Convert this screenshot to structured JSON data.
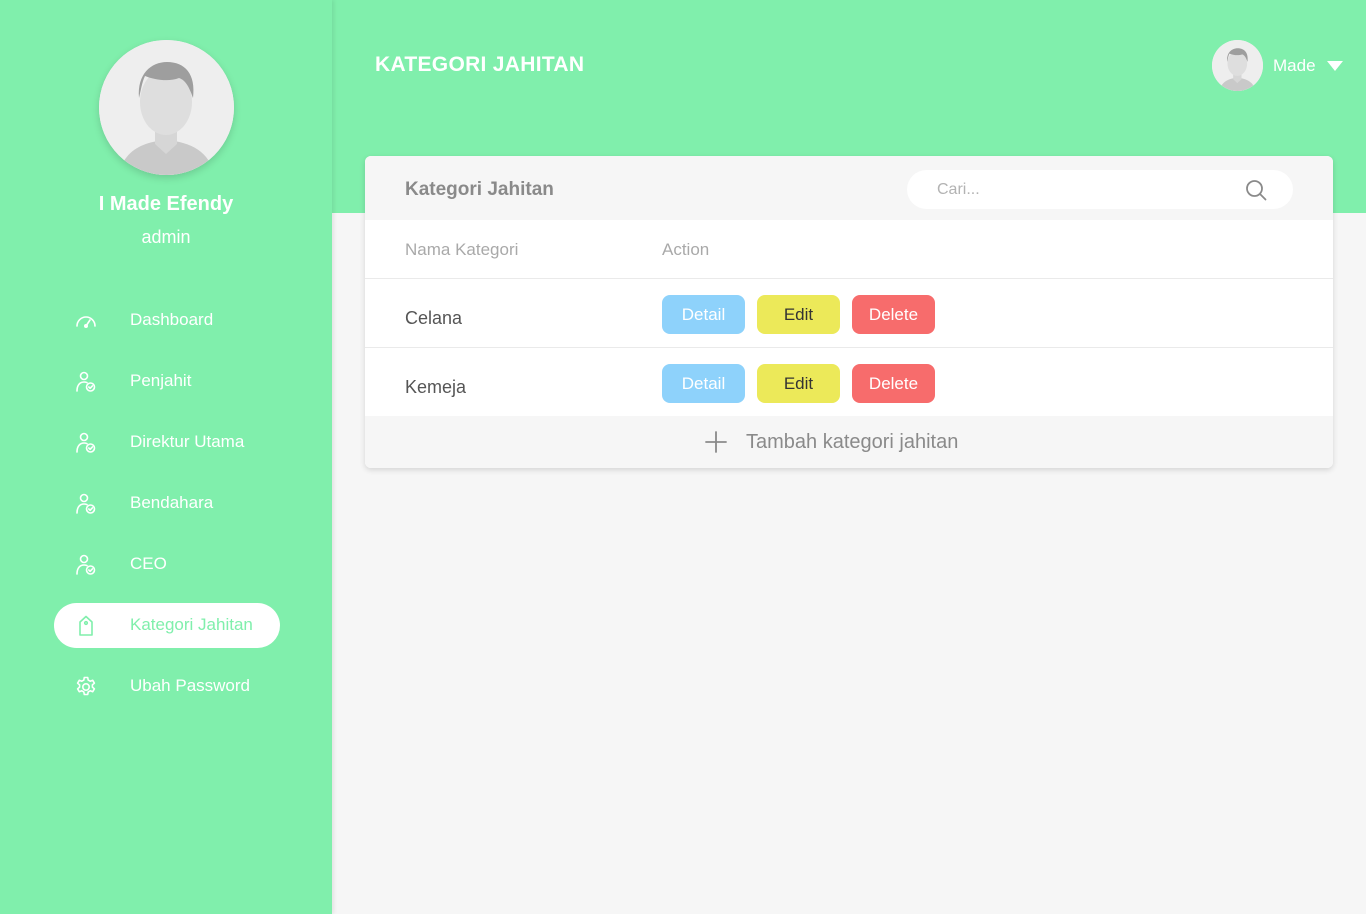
{
  "colors": {
    "accent": "#80efac",
    "detail": "#8ed2fb",
    "edit": "#ece959",
    "delete": "#f76c6c"
  },
  "sidebar": {
    "profile": {
      "name": "I Made Efendy",
      "role": "admin",
      "avatar_icon": "user-avatar-icon"
    },
    "items": [
      {
        "label": "Dashboard",
        "icon": "gauge-icon",
        "active": false
      },
      {
        "label": "Penjahit",
        "icon": "user-check-icon",
        "active": false
      },
      {
        "label": "Direktur Utama",
        "icon": "user-check-icon",
        "active": false
      },
      {
        "label": "Bendahara",
        "icon": "user-check-icon",
        "active": false
      },
      {
        "label": "CEO",
        "icon": "user-check-icon",
        "active": false
      },
      {
        "label": "Kategori Jahitan",
        "icon": "tag-icon",
        "active": true
      },
      {
        "label": "Ubah Password",
        "icon": "gear-icon",
        "active": false
      }
    ]
  },
  "header": {
    "title": "KATEGORI JAHITAN",
    "user": {
      "name": "Made"
    }
  },
  "card": {
    "title": "Kategori Jahitan",
    "search": {
      "placeholder": "Cari...",
      "value": ""
    },
    "columns": [
      "Nama Kategori",
      "Action"
    ],
    "rows": [
      {
        "name": "Celana"
      },
      {
        "name": "Kemeja"
      }
    ],
    "actions": {
      "detail": "Detail",
      "edit": "Edit",
      "delete": "Delete"
    },
    "add_label": "Tambah kategori jahitan"
  }
}
